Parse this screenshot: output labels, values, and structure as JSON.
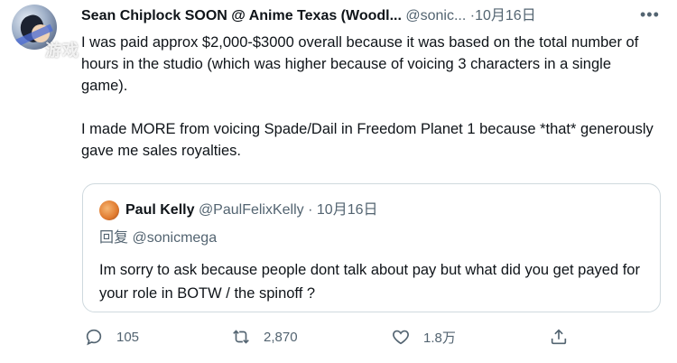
{
  "tweet": {
    "display_name": "Sean Chiplock SOON @ Anime Texas (Woodl...",
    "handle": "@sonic...",
    "separator": "·",
    "date": "10月16日",
    "more_label": "•••",
    "watermark": "游戏",
    "paragraphs": [
      "I was paid approx $2,000-$3000 overall because it was based on the total number of hours in the studio (which was higher because of voicing 3 characters in a single game).",
      "I made MORE from voicing Spade/Dail in Freedom Planet 1 because *that* generously gave me sales royalties."
    ]
  },
  "quoted_tweet": {
    "display_name": "Paul Kelly",
    "handle": "@PaulFelixKelly",
    "separator": "·",
    "date": "10月16日",
    "reply_prefix": "回复",
    "reply_to": "@sonicmega",
    "text": "Im sorry to ask because people dont talk about pay but what did you get payed for your role in BOTW / the spinoff ?"
  },
  "actions": {
    "reply_count": "105",
    "retweet_count": "2,870",
    "like_count": "1.8万"
  },
  "icons": {
    "reply": "comment-icon",
    "retweet": "retweet-icon",
    "like": "heart-icon",
    "share": "share-icon",
    "more": "more-icon"
  },
  "colors": {
    "text_primary": "#0f1419",
    "text_secondary": "#536471",
    "border": "#cfd9de"
  }
}
